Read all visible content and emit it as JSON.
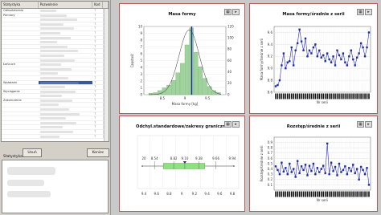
{
  "grid": {
    "columns": [
      "Statystyka",
      "Pozwolenie",
      "Kod",
      ""
    ],
    "rows": [
      {
        "c1": "Odkształcenie",
        "c3": "T"
      },
      {
        "c1": "Pomiary",
        "c3": "T"
      },
      {
        "c1": "",
        "c3": "T"
      },
      {
        "c1": "",
        "c3": "T"
      },
      {
        "c1": "",
        "c3": "T"
      },
      {
        "c1": "",
        "c3": "T"
      },
      {
        "c1": "",
        "c3": "T"
      },
      {
        "c1": "",
        "c3": "T"
      },
      {
        "c1": "",
        "c3": "T"
      },
      {
        "c1": "",
        "c3": "T"
      },
      {
        "c1": "",
        "c3": "T"
      },
      {
        "c1": "",
        "c3": "T"
      },
      {
        "c1": "Łańcuch",
        "c3": "T"
      },
      {
        "c1": "",
        "c3": "T"
      },
      {
        "c1": "",
        "c3": "T"
      },
      {
        "c1": "",
        "c3": "T"
      },
      {
        "c1": "Wpłatarki",
        "c3": "T",
        "selected": true
      },
      {
        "c1": "",
        "c3": "T"
      },
      {
        "c1": "Wyciąganie",
        "c3": "T"
      },
      {
        "c1": "",
        "c3": "T"
      },
      {
        "c1": "Zakończenie",
        "c3": "T"
      },
      {
        "c1": "",
        "c3": "T"
      },
      {
        "c1": "",
        "c3": "T"
      },
      {
        "c1": "",
        "c3": "T"
      },
      {
        "c1": "",
        "c3": "T"
      },
      {
        "c1": "",
        "c3": "T"
      },
      {
        "c1": "",
        "c3": "T"
      },
      {
        "c1": "",
        "c3": "T"
      },
      {
        "c1": "",
        "c3": "T"
      }
    ]
  },
  "buttons": {
    "usun": "Usuń",
    "koniec": "Koniec"
  },
  "stat_label": "Statystyka",
  "charts": {
    "histogram": {
      "title": "Masa formy"
    },
    "trend_mean": {
      "title": "Masa formy/średnie z serii"
    },
    "std": {
      "title": "Odchyl.standardowe/zakresy graniczne"
    },
    "trend_range": {
      "title": "Rozstęp/średnie z serii"
    }
  },
  "icons": {
    "card_icons": [
      "chart-icon",
      "close-icon"
    ]
  },
  "chart_data": [
    {
      "type": "bar",
      "title": "Masa formy",
      "xlabel": "Masa formy [kg]",
      "ylabel": "Częstość",
      "ylabel_right": "",
      "categories": [
        "8.2",
        "8.3",
        "8.4",
        "8.5",
        "8.6",
        "8.7",
        "8.8",
        "8.9",
        "9.0",
        "9.1",
        "9.2",
        "9.3",
        "9.4",
        "9.5",
        "9.6",
        "9.7"
      ],
      "values": [
        0.2,
        0.3,
        0.6,
        1.0,
        1.4,
        2.1,
        3.2,
        4.6,
        7.3,
        9.8,
        6.2,
        4.1,
        2.4,
        1.2,
        0.6,
        0.3
      ],
      "ylim": [
        0,
        10
      ],
      "ylim_right": [
        0,
        120
      ],
      "yticks": [
        "0",
        "1",
        "2",
        "3",
        "4",
        "5",
        "6",
        "7",
        "8",
        "9",
        "10"
      ],
      "yticks_right": [
        "0",
        "20",
        "40",
        "60",
        "80",
        "100",
        "120"
      ],
      "xticks": [
        "8.5",
        "9",
        "9.5"
      ],
      "marker_x": 9.1,
      "colors": {
        "bar": "#9ed39b",
        "bar_edge": "#6aa169",
        "marker": "#1d2fa0",
        "curve": "#333333"
      }
    },
    {
      "type": "line",
      "title": "Masa formy/średnie z serii",
      "xlabel": "Nr serii",
      "ylabel": "Masa formy/średnie z serii",
      "ylim": [
        8.6,
        9.7
      ],
      "yticks": [
        "9.6",
        "9.4",
        "9.2",
        "9.0",
        "8.8",
        "8.6"
      ],
      "values": [
        8.7,
        8.72,
        8.8,
        9.05,
        9.25,
        9.0,
        9.1,
        9.12,
        9.35,
        9.05,
        9.3,
        9.42,
        9.65,
        9.45,
        9.3,
        9.5,
        9.2,
        9.3,
        9.25,
        9.35,
        9.4,
        9.2,
        9.3,
        9.18,
        9.22,
        9.12,
        9.25,
        9.15,
        9.1,
        9.2,
        9.05,
        9.3,
        9.22,
        9.15,
        9.25,
        9.1,
        9.05,
        9.2,
        9.3,
        9.15,
        9.05,
        9.18,
        9.25,
        9.42,
        9.35,
        9.2,
        9.35,
        9.6
      ],
      "colors": {
        "line": "#2a2acf",
        "marker": "#1d2fa0"
      }
    },
    {
      "type": "scatter",
      "title": "Odchyl.standardowe/zakresy graniczne",
      "points": [
        {
          "x": 8.7,
          "label": "8.54"
        },
        {
          "x": 8.96,
          "label": "8.82"
        },
        {
          "x": 9.11,
          "label": "9.10"
        },
        {
          "x": 9.3,
          "label": "9.38"
        },
        {
          "x": 9.53,
          "label": "9.66"
        }
      ],
      "end_labels": [
        "20",
        "9.94"
      ],
      "xticks": [
        "9.4",
        "9.6",
        "8.8",
        "9",
        "9.2",
        "9.4",
        "9.6",
        "9.8"
      ],
      "band": [
        8.82,
        9.38
      ],
      "colors": {
        "band": "#8fe07e",
        "band_edge": "#4da34a",
        "line": "#333333",
        "marker": "#1d2fa0"
      }
    },
    {
      "type": "line",
      "title": "Rozstęp/średnie z serii",
      "xlabel": "Nr serii",
      "ylabel": "Rozstęp/średnie z serii",
      "ylim": [
        0,
        1.0
      ],
      "yticks": [
        "0.9",
        "0.8",
        "0.7",
        "0.6",
        "0.5",
        "0.4",
        "0.3",
        "0.2",
        "0.1"
      ],
      "values": [
        0.45,
        0.38,
        0.3,
        0.52,
        0.35,
        0.42,
        0.3,
        0.5,
        0.34,
        0.4,
        0.25,
        0.55,
        0.32,
        0.45,
        0.38,
        0.48,
        0.28,
        0.46,
        0.36,
        0.5,
        0.3,
        0.42,
        0.34,
        0.4,
        0.46,
        0.32,
        0.88,
        0.3,
        0.52,
        0.36,
        0.44,
        0.28,
        0.5,
        0.34,
        0.38,
        0.45,
        0.3,
        0.42,
        0.36,
        0.48,
        0.32,
        0.4,
        0.2,
        0.44,
        0.38,
        0.3,
        0.42,
        0.1
      ],
      "colors": {
        "line": "#2a2acf",
        "marker": "#1d2fa0"
      }
    }
  ]
}
